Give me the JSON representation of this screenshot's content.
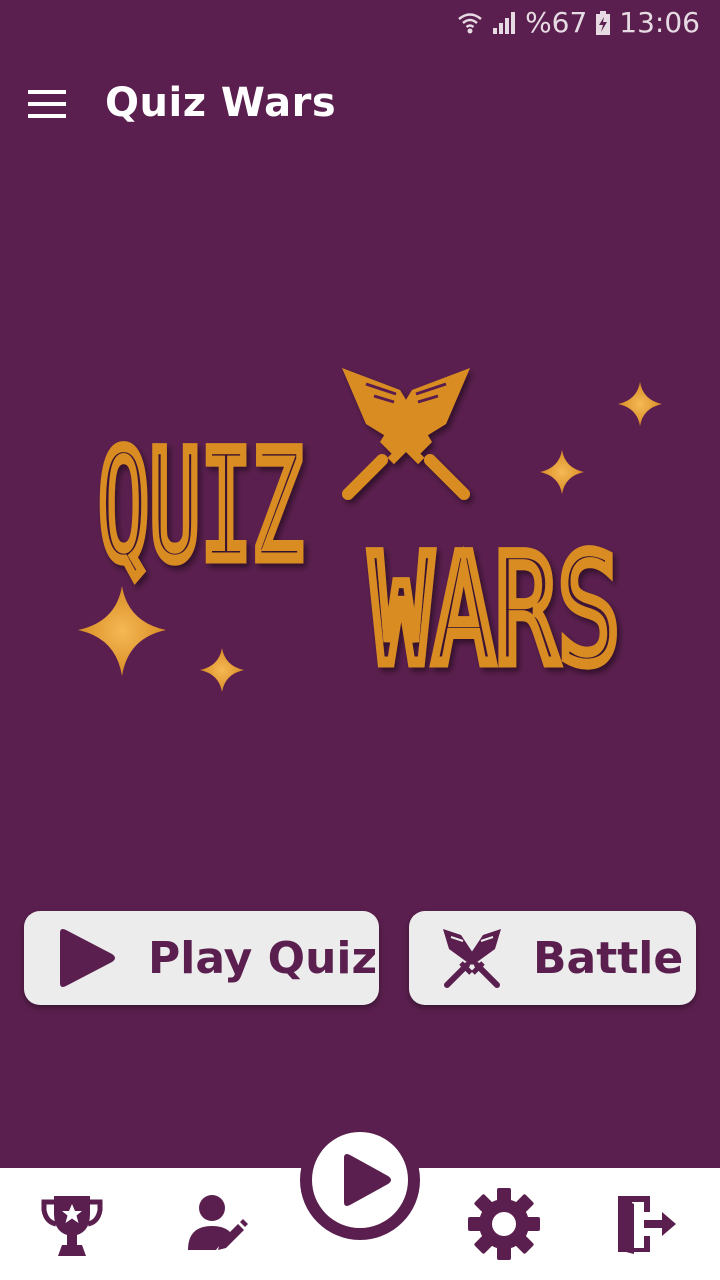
{
  "status_bar": {
    "battery_text": "%67",
    "time": "13:06"
  },
  "app_bar": {
    "title": "Quiz Wars",
    "menu_icon": "hamburger-menu-icon"
  },
  "logo": {
    "line1": "QUIZ",
    "line2": "WARS"
  },
  "buttons": {
    "play_quiz": {
      "label": "Play Quiz",
      "icon": "play-icon"
    },
    "battle": {
      "label": "Battle",
      "icon": "crossed-swords-icon"
    }
  },
  "bottom_nav": {
    "items": [
      {
        "icon": "trophy-icon"
      },
      {
        "icon": "edit-profile-icon"
      },
      {
        "icon": "play-icon"
      },
      {
        "icon": "gear-icon"
      },
      {
        "icon": "logout-icon"
      }
    ]
  },
  "colors": {
    "background": "#5a1f4e",
    "accent_gold": "#d98c24",
    "button_bg": "#ececec",
    "nav_bg": "#ffffff"
  }
}
